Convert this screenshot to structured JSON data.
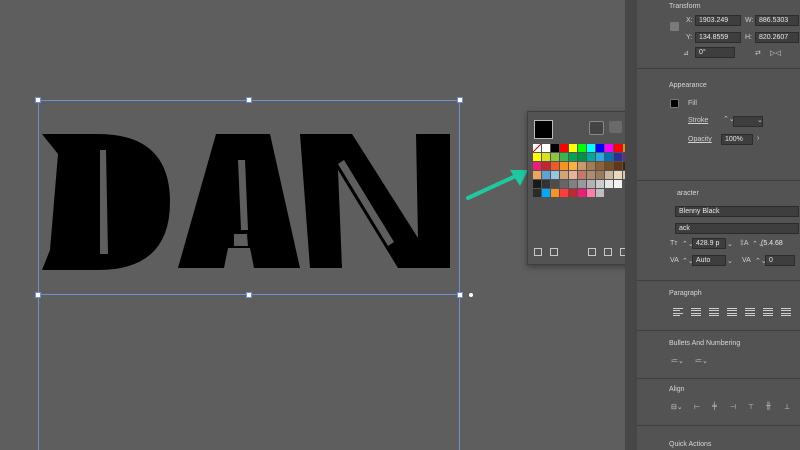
{
  "artwork": {
    "text": "DAN",
    "fill": "#000000"
  },
  "selection_color": "#6e8fd0",
  "annotation_arrow_color": "#1fc9a0",
  "swatches": {
    "current_fill": "#000000",
    "rows": [
      [
        "none",
        "#ffffff",
        "#000000",
        "#ff0000",
        "#ffff00",
        "#00ff00",
        "#00ffff",
        "#0000ff",
        "#ff00ff",
        "#ff0000",
        "#ff7f00",
        "#ffd400"
      ],
      [
        "#ffff00",
        "#d9e021",
        "#8cc63f",
        "#39b54a",
        "#00a651",
        "#009245",
        "#00a99d",
        "#29abe2",
        "#0071bc",
        "#2e3192",
        "#662d91",
        "#93278f"
      ],
      [
        "#ed1e79",
        "#c1272d",
        "#f15a24",
        "#f7931e",
        "#fbb03b",
        "#c69c6d",
        "#a67c52",
        "#8c6239",
        "#754c24",
        "#603813",
        "#42210b",
        "#f7a8c4"
      ],
      [
        "#f2a35a",
        "#5ea3d6",
        "#9ac3e0",
        "#d4a373",
        "#e8b39a",
        "#c8786a",
        "#b08c6e",
        "#9c7a5c",
        "#cbb79d",
        "#e9d8c0",
        "#e7c6a7",
        "#d8a3a3"
      ],
      [
        "#1a1a1a",
        "#333333",
        "#4d4d4d",
        "#666666",
        "#808080",
        "#999999",
        "#b3b3b3",
        "#cccccc",
        "#e6e6e6",
        "#f2f2f2",
        "",
        ""
      ],
      [
        "#2b2b2b",
        "#00aaff",
        "#f7931e",
        "#ff3b3b",
        "#c1272d",
        "#ed1e79",
        "#ff7bac",
        "#bdbdbd",
        "",
        "",
        "",
        ""
      ]
    ]
  },
  "transform": {
    "title": "Transform",
    "x_label": "X:",
    "x_value": "1903.249",
    "w_label": "W:",
    "w_value": "886.5303",
    "y_label": "Y:",
    "y_value": "134.8559",
    "h_label": "H:",
    "h_value": "820.2607",
    "angle_value": "0°"
  },
  "appearance": {
    "title": "Appearance",
    "fill_label": "Fill",
    "stroke_label": "Stroke",
    "opacity_label": "Opacity",
    "opacity_value": "100%"
  },
  "character": {
    "title_partial": "aracter",
    "font_family": "Blenny Black",
    "font_style_partial": "ack",
    "font_size": "428.9 p",
    "leading": "(5.4.68",
    "tracking_mode": "Auto",
    "tracking": "0"
  },
  "paragraph": {
    "title": "Paragraph"
  },
  "bullets": {
    "title": "Bullets And Numbering"
  },
  "align": {
    "title": "Align"
  },
  "quick_actions": {
    "title": "Quick Actions"
  }
}
